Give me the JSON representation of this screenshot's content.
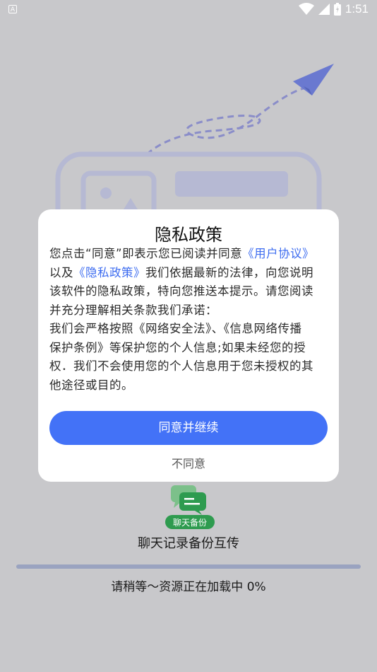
{
  "status_bar": {
    "time": "1:51",
    "left_indicator": "A"
  },
  "dialog": {
    "title": "隐私政策",
    "line1_pre": "您点击“同意”即表示您已阅读并同意",
    "link_user_agreement": "《用户协议》",
    "line2_pre": "以及",
    "link_privacy_policy": "《隐私政策》",
    "line2_post": "我们依据最新的法律，向您说明",
    "line3": "该软件的隐私政策，特向您推送本提示。请您阅读",
    "line4": "并充分理解相关条款我们承诺：",
    "line5": "我们会严格按照《网络安全法》、《信息网络传播",
    "line6": "保护条例》等保护您的个人信息;如果未经您的授",
    "line7": "权．我们不会使用您的个人信息用于您未授权的其",
    "line8": "他途径或目的。",
    "agree_label": "同意并继续",
    "disagree_label": "不同意"
  },
  "app": {
    "logo_text": "聊天备份",
    "name": "聊天记录备份互传"
  },
  "loading": {
    "text": "请稍等～资源正在加载中 0%",
    "progress": 0
  },
  "colors": {
    "accent": "#4372f7",
    "link": "#3d6cf0",
    "logo_green": "#2e9b4f"
  }
}
